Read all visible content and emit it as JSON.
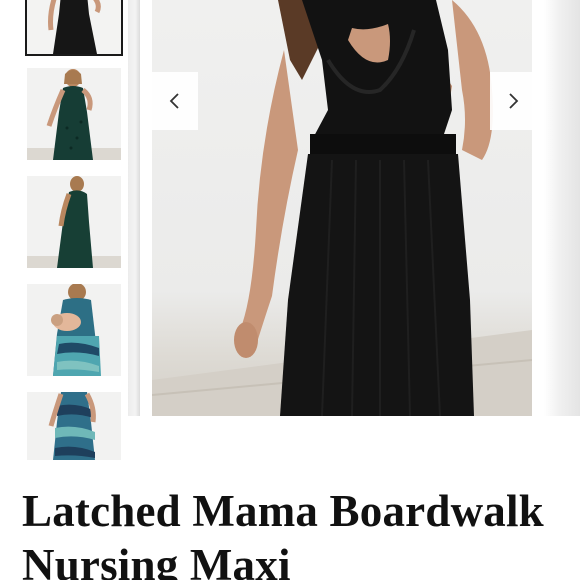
{
  "product": {
    "title": "Latched Mama Boardwalk Nursing Maxi"
  },
  "gallery": {
    "thumbnails": [
      {
        "label": "thumbnail-1",
        "color": "#1a1a1a"
      },
      {
        "label": "thumbnail-2",
        "color": "#163d35"
      },
      {
        "label": "thumbnail-3",
        "color": "#173f35"
      },
      {
        "label": "thumbnail-4",
        "color": "#3d8fa0"
      },
      {
        "label": "thumbnail-5",
        "color": "#2f6f8a"
      }
    ],
    "prev_icon": "chevron-left-icon",
    "next_icon": "chevron-right-icon"
  },
  "colors": {
    "dress": "#121212",
    "skin": "#c9987b",
    "hair": "#5a3a26",
    "floor": "#d4cfc7"
  }
}
